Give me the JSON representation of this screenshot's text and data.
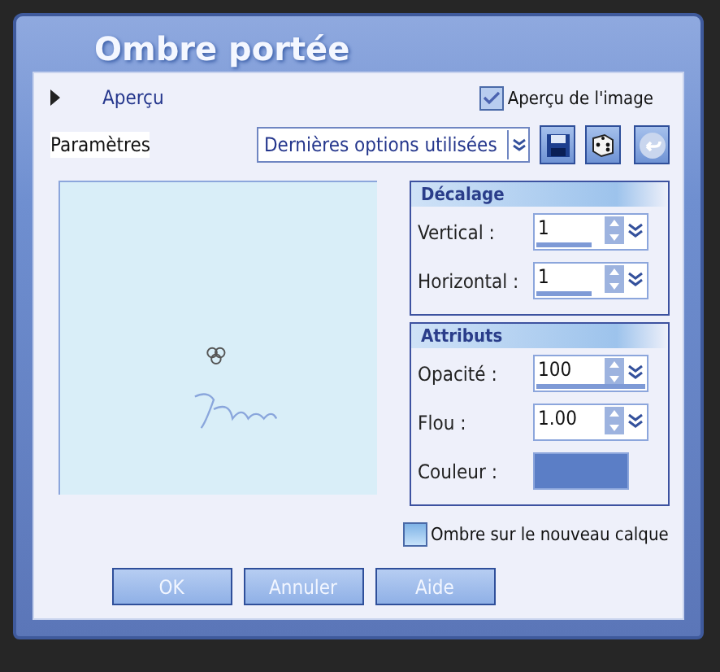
{
  "window": {
    "title": "Ombre portée"
  },
  "preview_toggle": {
    "label": "Aperçu",
    "expanded": false
  },
  "image_preview": {
    "label": "Aperçu de l'image",
    "checked": true
  },
  "presets": {
    "label": "Paramètres",
    "value": "Dernières options utilisées"
  },
  "groups": [
    {
      "title": "Décalage",
      "fields": [
        {
          "kind": "spin",
          "label": "Vertical :",
          "value": "1",
          "level": 0.5
        },
        {
          "kind": "spin",
          "label": "Horizontal :",
          "value": "1",
          "level": 0.5
        }
      ]
    },
    {
      "title": "Attributs",
      "fields": [
        {
          "kind": "spin",
          "label": "Opacité :",
          "value": "100",
          "level": 1
        },
        {
          "kind": "spin",
          "label": "Flou :",
          "value": "1.00"
        },
        {
          "kind": "color",
          "label": "Couleur :",
          "color": "#5b7ec6"
        }
      ]
    }
  ],
  "new_layer": {
    "label": "Ombre sur le nouveau calque",
    "checked": false
  },
  "buttons": [
    "OK",
    "Annuler",
    "Aide"
  ]
}
